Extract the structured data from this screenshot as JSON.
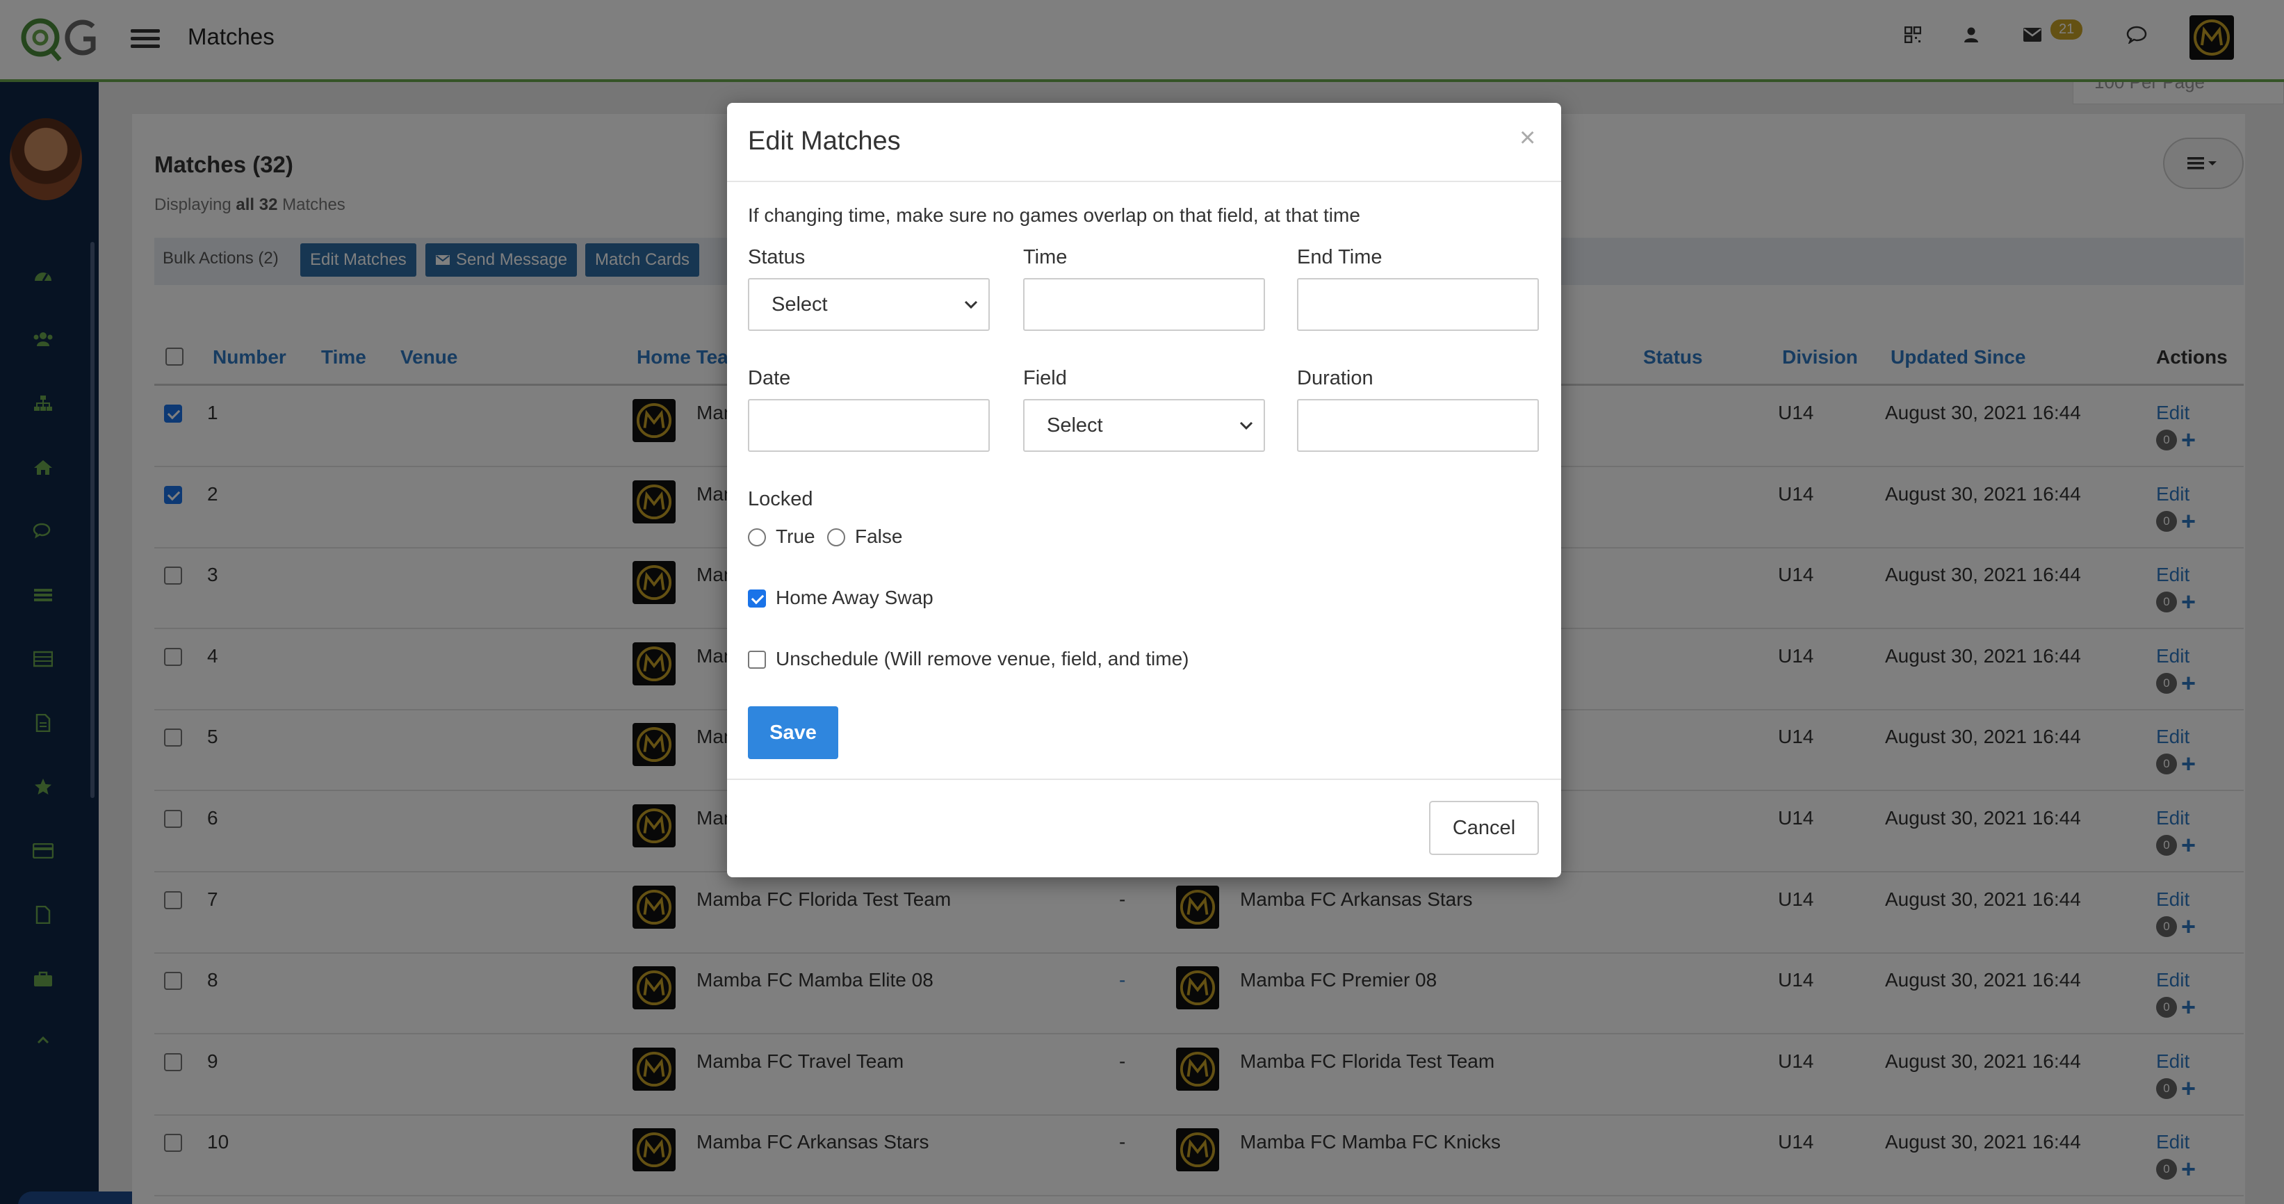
{
  "header": {
    "title": "Matches",
    "mail_count": "21"
  },
  "content": {
    "per_page": "100 Per Page",
    "list_title": "Matches (32)",
    "displaying_prefix": "Displaying ",
    "displaying_all": "all 32",
    "displaying_suffix": " Matches",
    "bulk_label": "Bulk Actions (2)",
    "bulk_buttons": [
      "Edit Matches",
      "Send Message",
      "Match Cards"
    ],
    "columns": [
      "Number",
      "Time",
      "Venue",
      "Home Team",
      "Status",
      "Division",
      "Updated Since",
      "Actions"
    ],
    "rows": [
      {
        "number": "1",
        "checked": true,
        "home": "Mamba FC",
        "dash": "",
        "away": "",
        "division": "U14",
        "updated": "August 30, 2021 16:44",
        "edit": "Edit",
        "count": "0"
      },
      {
        "number": "2",
        "checked": true,
        "home": "Mamba FC",
        "dash": "",
        "away": "",
        "division": "U14",
        "updated": "August 30, 2021 16:44",
        "edit": "Edit",
        "count": "0"
      },
      {
        "number": "3",
        "checked": false,
        "home": "Mamba FC",
        "dash": "",
        "away": "",
        "division": "U14",
        "updated": "August 30, 2021 16:44",
        "edit": "Edit",
        "count": "0"
      },
      {
        "number": "4",
        "checked": false,
        "home": "Mamba FC",
        "dash": "",
        "away": "",
        "division": "U14",
        "updated": "August 30, 2021 16:44",
        "edit": "Edit",
        "count": "0"
      },
      {
        "number": "5",
        "checked": false,
        "home": "Mamba FC",
        "dash": "",
        "away": "",
        "division": "U14",
        "updated": "August 30, 2021 16:44",
        "edit": "Edit",
        "count": "0"
      },
      {
        "number": "6",
        "checked": false,
        "home": "Mamba FC",
        "dash": "",
        "away": "",
        "division": "U14",
        "updated": "August 30, 2021 16:44",
        "edit": "Edit",
        "count": "0"
      },
      {
        "number": "7",
        "checked": false,
        "home": "Mamba FC Florida Test Team",
        "dash": "-",
        "away": "Mamba FC Arkansas Stars",
        "division": "U14",
        "updated": "August 30, 2021 16:44",
        "edit": "Edit",
        "count": "0"
      },
      {
        "number": "8",
        "checked": false,
        "home": "Mamba FC Mamba Elite 08",
        "dash": "-",
        "away": "Mamba FC Premier 08",
        "division": "U14",
        "updated": "August 30, 2021 16:44",
        "edit": "Edit",
        "count": "0"
      },
      {
        "number": "9",
        "checked": false,
        "home": "Mamba FC Travel Team",
        "dash": "-",
        "away": "Mamba FC Florida Test Team",
        "division": "U14",
        "updated": "August 30, 2021 16:44",
        "edit": "Edit",
        "count": "0"
      },
      {
        "number": "10",
        "checked": false,
        "home": "Mamba FC Arkansas Stars",
        "dash": "-",
        "away": "Mamba FC Mamba FC Knicks",
        "division": "U14",
        "updated": "August 30, 2021 16:44",
        "edit": "Edit",
        "count": "0"
      }
    ]
  },
  "modal": {
    "title": "Edit Matches",
    "close": "×",
    "note": "If changing time, make sure no games overlap on that field, at that time",
    "status_label": "Status",
    "status_value": "Select",
    "time_label": "Time",
    "time_value": "",
    "end_time_label": "End Time",
    "end_time_value": "",
    "date_label": "Date",
    "date_value": "",
    "field_label": "Field",
    "field_value": "Select",
    "duration_label": "Duration",
    "duration_value": "",
    "locked_label": "Locked",
    "locked_true": "True",
    "locked_false": "False",
    "home_away_swap": "Home Away Swap",
    "home_away_swap_checked": true,
    "unschedule": "Unschedule (Will remove venue, field, and time)",
    "unschedule_checked": false,
    "save": "Save",
    "cancel": "Cancel"
  },
  "colors": {
    "sidebar": "#0f2747",
    "accent": "#2f78c2",
    "primary_button": "#2f86de",
    "topbar_border": "#6aa84f"
  },
  "icons": [
    "qrcode-icon",
    "user-icon",
    "mail-icon",
    "chat-icon",
    "dashboard-icon",
    "users-icon",
    "sitemap-icon",
    "home-icon",
    "comments-icon",
    "list-icon",
    "table-icon",
    "document-icon",
    "star-icon",
    "credit-card-icon",
    "file-icon",
    "briefcase-icon",
    "chevron-up-icon"
  ]
}
